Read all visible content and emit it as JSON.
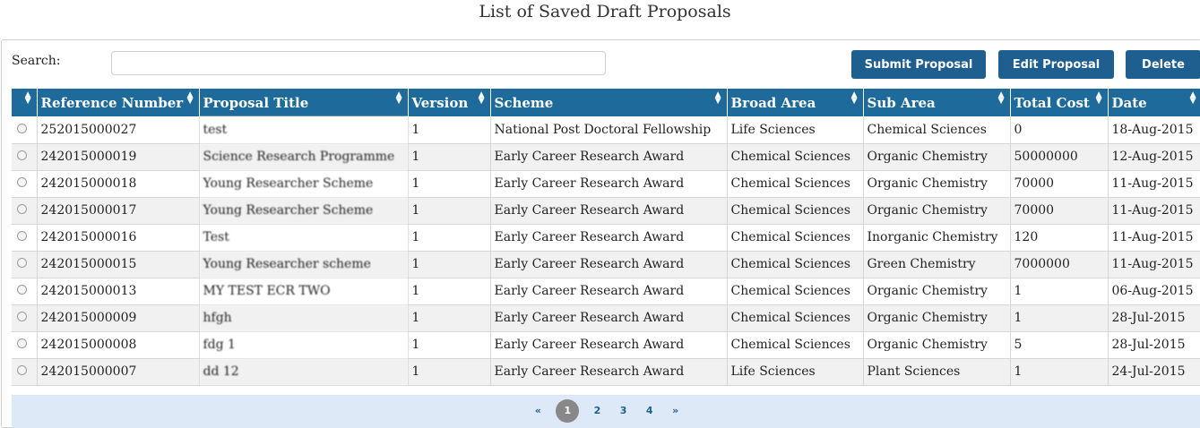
{
  "page": {
    "title": "List of Saved Draft Proposals"
  },
  "search": {
    "label": "Search:",
    "value": "",
    "placeholder": ""
  },
  "toolbar": {
    "submit_label": "Submit Proposal",
    "edit_label": "Edit Proposal",
    "delete_label": "Delete"
  },
  "table": {
    "sort_icon": "⌃⌄",
    "headers": [
      "Reference Number",
      "Proposal Title",
      "Version",
      "Scheme",
      "Broad Area",
      "Sub Area",
      "Total Cost",
      "Date"
    ],
    "rows": [
      {
        "ref": "252015000027",
        "title": "test",
        "version": "1",
        "scheme": "National Post Doctoral Fellowship",
        "broad": "Life Sciences",
        "sub": "Chemical Sciences",
        "cost": "0",
        "date": "18-Aug-2015"
      },
      {
        "ref": "242015000019",
        "title": "Science Research Programme",
        "version": "1",
        "scheme": "Early Career Research Award",
        "broad": "Chemical Sciences",
        "sub": "Organic Chemistry",
        "cost": "50000000",
        "date": "12-Aug-2015"
      },
      {
        "ref": "242015000018",
        "title": "Young Researcher Scheme",
        "version": "1",
        "scheme": "Early Career Research Award",
        "broad": "Chemical Sciences",
        "sub": "Organic Chemistry",
        "cost": "70000",
        "date": "11-Aug-2015"
      },
      {
        "ref": "242015000017",
        "title": "Young Researcher Scheme",
        "version": "1",
        "scheme": "Early Career Research Award",
        "broad": "Chemical Sciences",
        "sub": "Organic Chemistry",
        "cost": "70000",
        "date": "11-Aug-2015"
      },
      {
        "ref": "242015000016",
        "title": "Test",
        "version": "1",
        "scheme": "Early Career Research Award",
        "broad": "Chemical Sciences",
        "sub": "Inorganic Chemistry",
        "cost": "120",
        "date": "11-Aug-2015"
      },
      {
        "ref": "242015000015",
        "title": "Young Researcher scheme",
        "version": "1",
        "scheme": "Early Career Research Award",
        "broad": "Chemical Sciences",
        "sub": "Green Chemistry",
        "cost": "7000000",
        "date": "11-Aug-2015"
      },
      {
        "ref": "242015000013",
        "title": "MY TEST ECR TWO",
        "version": "1",
        "scheme": "Early Career Research Award",
        "broad": "Chemical Sciences",
        "sub": "Organic Chemistry",
        "cost": "1",
        "date": "06-Aug-2015"
      },
      {
        "ref": "242015000009",
        "title": "hfgh",
        "version": "1",
        "scheme": "Early Career Research Award",
        "broad": "Chemical Sciences",
        "sub": "Organic Chemistry",
        "cost": "1",
        "date": "28-Jul-2015"
      },
      {
        "ref": "242015000008",
        "title": "fdg 1",
        "version": "1",
        "scheme": "Early Career Research Award",
        "broad": "Chemical Sciences",
        "sub": "Organic Chemistry",
        "cost": "5",
        "date": "28-Jul-2015"
      },
      {
        "ref": "242015000007",
        "title": "dd 12",
        "version": "1",
        "scheme": "Early Career Research Award",
        "broad": "Life Sciences",
        "sub": "Plant Sciences",
        "cost": "1",
        "date": "24-Jul-2015"
      }
    ]
  },
  "pagination": {
    "prev": "«",
    "pages": [
      "1",
      "2",
      "3",
      "4"
    ],
    "active": "1",
    "next": "»"
  },
  "colors": {
    "header_bg": "#1e6a9b",
    "button_bg": "#1e5f8f",
    "pager_bg": "#dde9f6"
  }
}
